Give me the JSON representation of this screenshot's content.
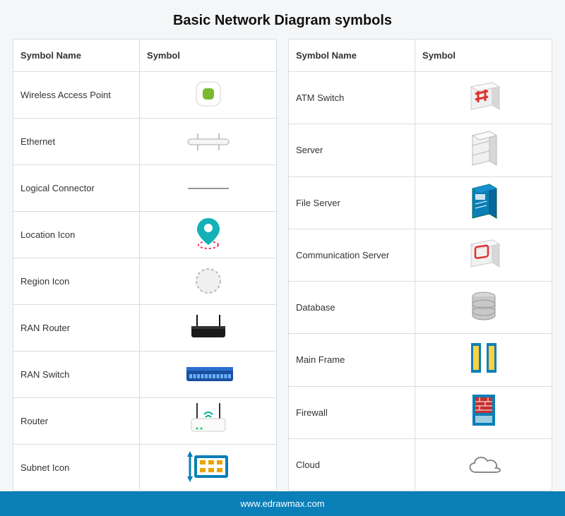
{
  "title": "Basic Network Diagram symbols",
  "headers": {
    "name": "Symbol Name",
    "symbol": "Symbol"
  },
  "left": [
    {
      "name": "Wireless Access Point",
      "icon": "wap"
    },
    {
      "name": "Ethernet",
      "icon": "ethernet"
    },
    {
      "name": "Logical Connector",
      "icon": "logical"
    },
    {
      "name": "Location Icon",
      "icon": "location"
    },
    {
      "name": "Region Icon",
      "icon": "region"
    },
    {
      "name": "RAN Router",
      "icon": "ranrouter"
    },
    {
      "name": "RAN Switch",
      "icon": "ranswitch"
    },
    {
      "name": "Router",
      "icon": "router"
    },
    {
      "name": "Subnet Icon",
      "icon": "subnet"
    }
  ],
  "right": [
    {
      "name": "ATM Switch",
      "icon": "atmswitch"
    },
    {
      "name": "Server",
      "icon": "server"
    },
    {
      "name": "File Server",
      "icon": "fileserver"
    },
    {
      "name": "Communication Server",
      "icon": "commserver"
    },
    {
      "name": "Database",
      "icon": "database"
    },
    {
      "name": "Main Frame",
      "icon": "mainframe"
    },
    {
      "name": "Firewall",
      "icon": "firewall"
    },
    {
      "name": "Cloud",
      "icon": "cloud"
    }
  ],
  "footer": "www.edrawmax.com"
}
